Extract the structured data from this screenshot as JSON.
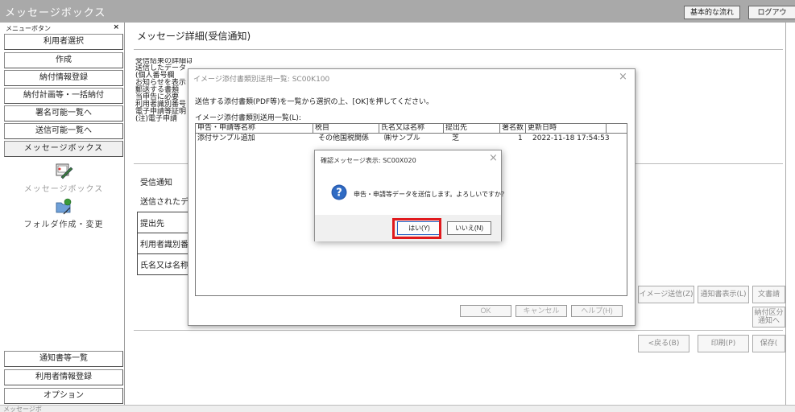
{
  "app": {
    "title": "メッセージボックス",
    "header_buttons": [
      "基本的な流れ",
      "ログアウ"
    ]
  },
  "sidebar": {
    "caption": "メニューボタン",
    "close_glyph": "×",
    "top_buttons": [
      "利用者選択",
      "作成",
      "納付情報登録",
      "納付計画等・一括納付",
      "署名可能一覧へ",
      "送信可能一覧へ",
      "メッセージボックス"
    ],
    "icon_items": [
      "メッセージボックス",
      "フォルダ作成・変更"
    ],
    "bottom_buttons": [
      "通知書等一覧",
      "利用者情報登録",
      "オプション"
    ]
  },
  "main": {
    "title": "メッセージ詳細(受信通知)",
    "intro_lines": [
      "受信結果の詳細は以下のとおりです。",
      "送信したデータ",
      "(個人番号欄",
      "お知らせを表示",
      "郵送する書類",
      "当申告に必要",
      "利用者識別番号",
      "電子申請等証明",
      "(注)電子申請"
    ],
    "section_label": "受信通知",
    "section_text": "送信されたデ",
    "table_rows": [
      "提出先",
      "利用者識別番",
      "氏名又は名称"
    ],
    "right_buttons": [
      "イメージ送信(Z)",
      "通知書表示(L)",
      "文書請",
      "納付区分\n通知へ"
    ],
    "nav_buttons": [
      "<戻る(B)",
      "印刷(P)",
      "保存("
    ]
  },
  "dialog1": {
    "title": "イメージ添付書類別送用一覧: SC00K100",
    "close_glyph": "×",
    "instruction": "送信する添付書類(PDF等)を一覧から選択の上、[OK]を押してください。",
    "list_label": "イメージ添付書類別送用一覧(L):",
    "columns": [
      "申告・申請等名称",
      "税目",
      "氏名又は名称",
      "提出先",
      "署名数",
      "更新日時"
    ],
    "rows": [
      {
        "name": "添付サンプル追加",
        "tax": "その他国税関係",
        "person": "㈱サンプル",
        "office": "芝",
        "sign_count": "1",
        "updated": "2022-11-18 17:54:53"
      }
    ],
    "buttons": [
      "OK",
      "キャンセル",
      "ヘルプ(H)"
    ]
  },
  "dialog2": {
    "title": "確認メッセージ表示: SC00X020",
    "close_glyph": "×",
    "message": "申告・申請等データを送信します。よろしいですか？",
    "yes_label": "はい(Y)",
    "no_label": "いいえ(N)",
    "icon": "question-icon"
  },
  "status": {
    "left_text": "メッセージボ"
  },
  "colors": {
    "titlebar": "#a9a9a9",
    "highlight": "#e0191d",
    "question_icon": "#2a5db0"
  }
}
